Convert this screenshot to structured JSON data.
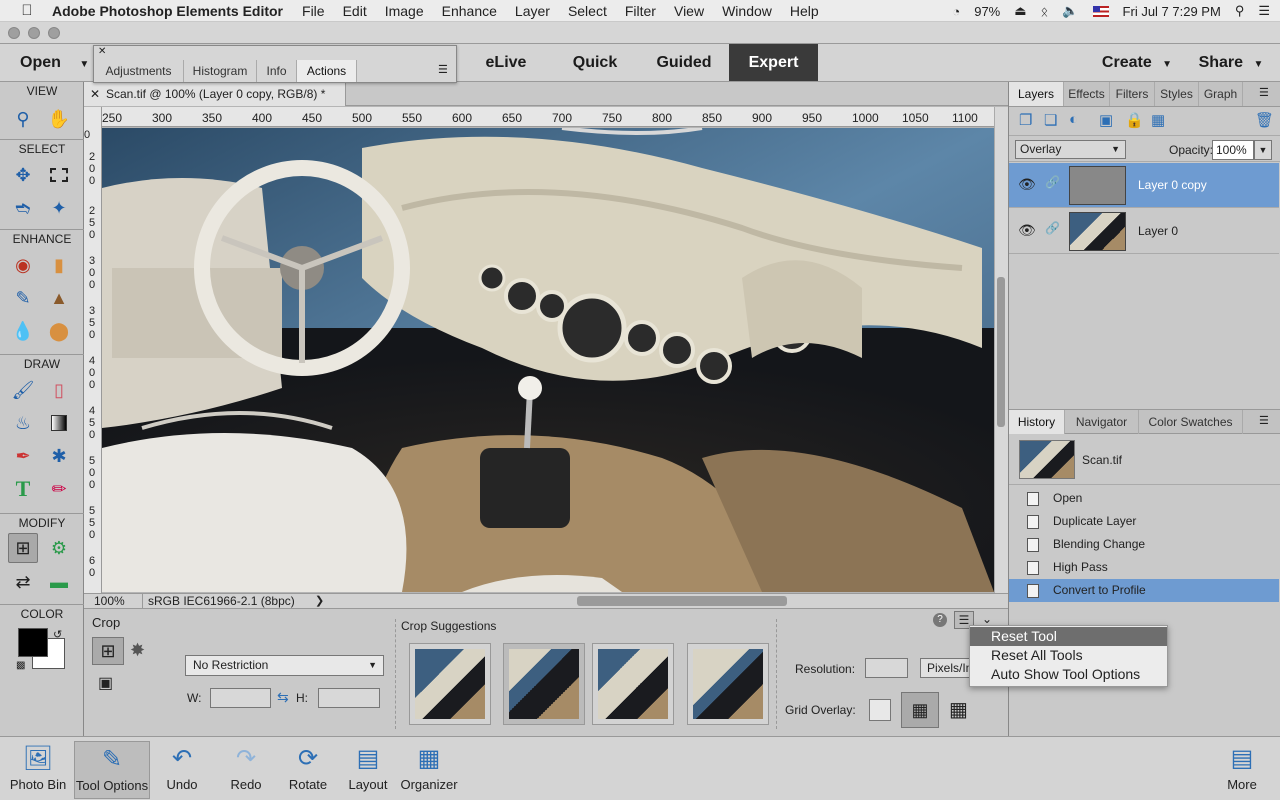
{
  "menubar": {
    "app_name": "Adobe Photoshop Elements Editor",
    "items": [
      "File",
      "Edit",
      "Image",
      "Enhance",
      "Layer",
      "Select",
      "Filter",
      "View",
      "Window",
      "Help"
    ],
    "battery": "97%",
    "clock": "Fri Jul 7  7:29 PM"
  },
  "topbar": {
    "open": "Open",
    "modes": [
      "eLive",
      "Quick",
      "Guided",
      "Expert"
    ],
    "active_mode": "Expert",
    "create": "Create",
    "share": "Share"
  },
  "float_panel": {
    "tabs": [
      "Adjustments",
      "Histogram",
      "Info",
      "Actions"
    ],
    "active_tab": "Actions"
  },
  "toolbar": {
    "sections": [
      "VIEW",
      "SELECT",
      "ENHANCE",
      "DRAW",
      "MODIFY",
      "COLOR"
    ],
    "tool_icons": [
      "zoom-icon",
      "hand-icon",
      "move-icon",
      "marquee-icon",
      "lasso-icon",
      "magic-wand-icon",
      "red-eye-icon",
      "spot-healing-icon",
      "smart-brush-icon",
      "clone-stamp-icon",
      "blur-icon",
      "sponge-icon",
      "brush-icon",
      "eraser-icon",
      "paint-bucket-icon",
      "gradient-icon",
      "eyedropper-icon",
      "custom-shape-icon",
      "type-icon",
      "pencil-icon",
      "crop-icon",
      "recompose-icon",
      "content-aware-move-icon",
      "straighten-icon"
    ],
    "fg_color": "#000000",
    "bg_color": "#ffffff"
  },
  "document": {
    "tab_title": "Scan.tif @ 100% (Layer 0 copy, RGB/8) *",
    "ruler_h": [
      "250",
      "300",
      "350",
      "400",
      "450",
      "500",
      "550",
      "600",
      "650",
      "700",
      "750",
      "800",
      "850",
      "900",
      "950",
      "1000",
      "1050",
      "1100"
    ],
    "ruler_v": [
      [
        "2",
        "0",
        "0"
      ],
      [
        "2",
        "5",
        "0"
      ],
      [
        "3",
        "0",
        "0"
      ],
      [
        "3",
        "5",
        "0"
      ],
      [
        "4",
        "0",
        "0"
      ],
      [
        "4",
        "5",
        "0"
      ],
      [
        "5",
        "0",
        "0"
      ],
      [
        "5",
        "5",
        "0"
      ],
      [
        "6",
        "0"
      ]
    ],
    "zoom": "100%",
    "profile": "sRGB IEC61966-2.1 (8bpc)"
  },
  "tool_options": {
    "tool_name": "Crop",
    "aspect": "No Restriction",
    "w_label": "W:",
    "h_label": "H:",
    "suggestions_label": "Crop Suggestions",
    "resolution_label": "Resolution:",
    "resolution_unit": "Pixels/In",
    "grid_label": "Grid Overlay:"
  },
  "options_menu": {
    "items": [
      "Reset Tool",
      "Reset All Tools",
      "Auto Show Tool Options"
    ],
    "highlighted": "Reset Tool"
  },
  "layers_panel": {
    "tabs": [
      "Layers",
      "Effects",
      "Filters",
      "Styles",
      "Graph"
    ],
    "active_tab": "Layers",
    "blend_mode": "Overlay",
    "opacity_label": "Opacity:",
    "opacity": "100%",
    "layers": [
      {
        "name": "Layer 0 copy",
        "selected": true
      },
      {
        "name": "Layer 0",
        "selected": false
      }
    ]
  },
  "history_panel": {
    "tabs": [
      "History",
      "Navigator",
      "Color Swatches"
    ],
    "active_tab": "History",
    "snapshot": "Scan.tif",
    "steps": [
      "Open",
      "Duplicate Layer",
      "Blending Change",
      "High Pass",
      "Convert to Profile"
    ],
    "current_step": "Convert to Profile"
  },
  "bottombar": {
    "items": [
      "Photo Bin",
      "Tool Options",
      "Undo",
      "Redo",
      "Rotate",
      "Layout",
      "Organizer"
    ],
    "more": "More"
  },
  "colors": {
    "accent": "#5b8fd0",
    "selection": "#6e9bd1"
  }
}
